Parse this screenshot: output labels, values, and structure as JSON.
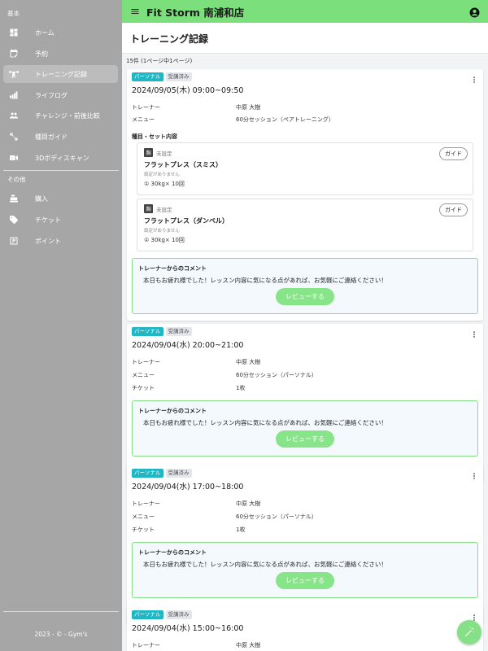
{
  "sidebar": {
    "section_basic": "基本",
    "section_other": "その他",
    "items": [
      {
        "label": "ホーム",
        "icon": "dashboard-icon"
      },
      {
        "label": "予約",
        "icon": "calendar-edit-icon"
      },
      {
        "label": "トレーニング記録",
        "icon": "weightlifting-icon",
        "active": true
      },
      {
        "label": "ライフログ",
        "icon": "dumbbell-icon"
      },
      {
        "label": "チャレンジ・前後比較",
        "icon": "group-icon"
      },
      {
        "label": "種目ガイド",
        "icon": "resize-arrows-icon"
      },
      {
        "label": "3Dボディスキャン",
        "icon": "3d-icon"
      }
    ],
    "other_items": [
      {
        "label": "購入",
        "icon": "cash-register-icon"
      },
      {
        "label": "チケット",
        "icon": "tag-icon"
      },
      {
        "label": "ポイント",
        "icon": "parking-icon"
      }
    ],
    "footer": "2023 - © - Gym's"
  },
  "header": {
    "shop_name": "Fit Storm 南浦和店"
  },
  "page": {
    "title": "トレーニング記録",
    "count": "15件 (1ページ中1ページ)"
  },
  "labels": {
    "trainer": "トレーナー",
    "menu": "メニュー",
    "ticket": "チケット",
    "exercise_section": "種目・セット内容",
    "guide": "ガイド",
    "comment_title": "トレーナーからのコメント",
    "review": "レビューする"
  },
  "cards": [
    {
      "type": "パーソナル",
      "status": "受講済み",
      "datetime": "2024/09/05(木) 09:00~09:50",
      "trainer": "中原 大樹",
      "menu": "60分セッション（ペアトレーニング）",
      "exercises": [
        {
          "category": "胸",
          "setting": "未設定",
          "name": "フラットプレス（スミス）",
          "note": "設定がありません",
          "sets": "① 30kg× 10回"
        },
        {
          "category": "胸",
          "setting": "未設定",
          "name": "フラットプレス（ダンベル）",
          "note": "設定がありません",
          "sets": "① 30kg× 10回"
        }
      ],
      "comment": "本日もお疲れ様でした！レッスン内容に気になる点があれば、お気軽にご連絡ください！"
    },
    {
      "type": "パーソナル",
      "status": "受講済み",
      "datetime": "2024/09/04(水) 20:00~21:00",
      "trainer": "中原 大樹",
      "menu": "60分セッション（パーソナル）",
      "ticket": "1枚",
      "comment": "本日もお疲れ様でした！レッスン内容に気になる点があれば、お気軽にご連絡ください！"
    },
    {
      "type": "パーソナル",
      "status": "受講済み",
      "datetime": "2024/09/04(水) 17:00~18:00",
      "trainer": "中原 大樹",
      "menu": "60分セッション（パーソナル）",
      "ticket": "1枚",
      "comment": "本日もお疲れ様でした！レッスン内容に気になる点があれば、お気軽にご連絡ください！"
    },
    {
      "type": "パーソナル",
      "status": "受講済み",
      "datetime": "2024/09/04(水) 15:00~16:00",
      "trainer": "中原 大樹"
    }
  ],
  "colors": {
    "header_green": "#7be07b",
    "sidebar_gray": "#a6a6a6",
    "badge_teal": "#1fb7c4",
    "comment_border": "#86df86"
  },
  "fab_icon": "magic-wand-icon"
}
